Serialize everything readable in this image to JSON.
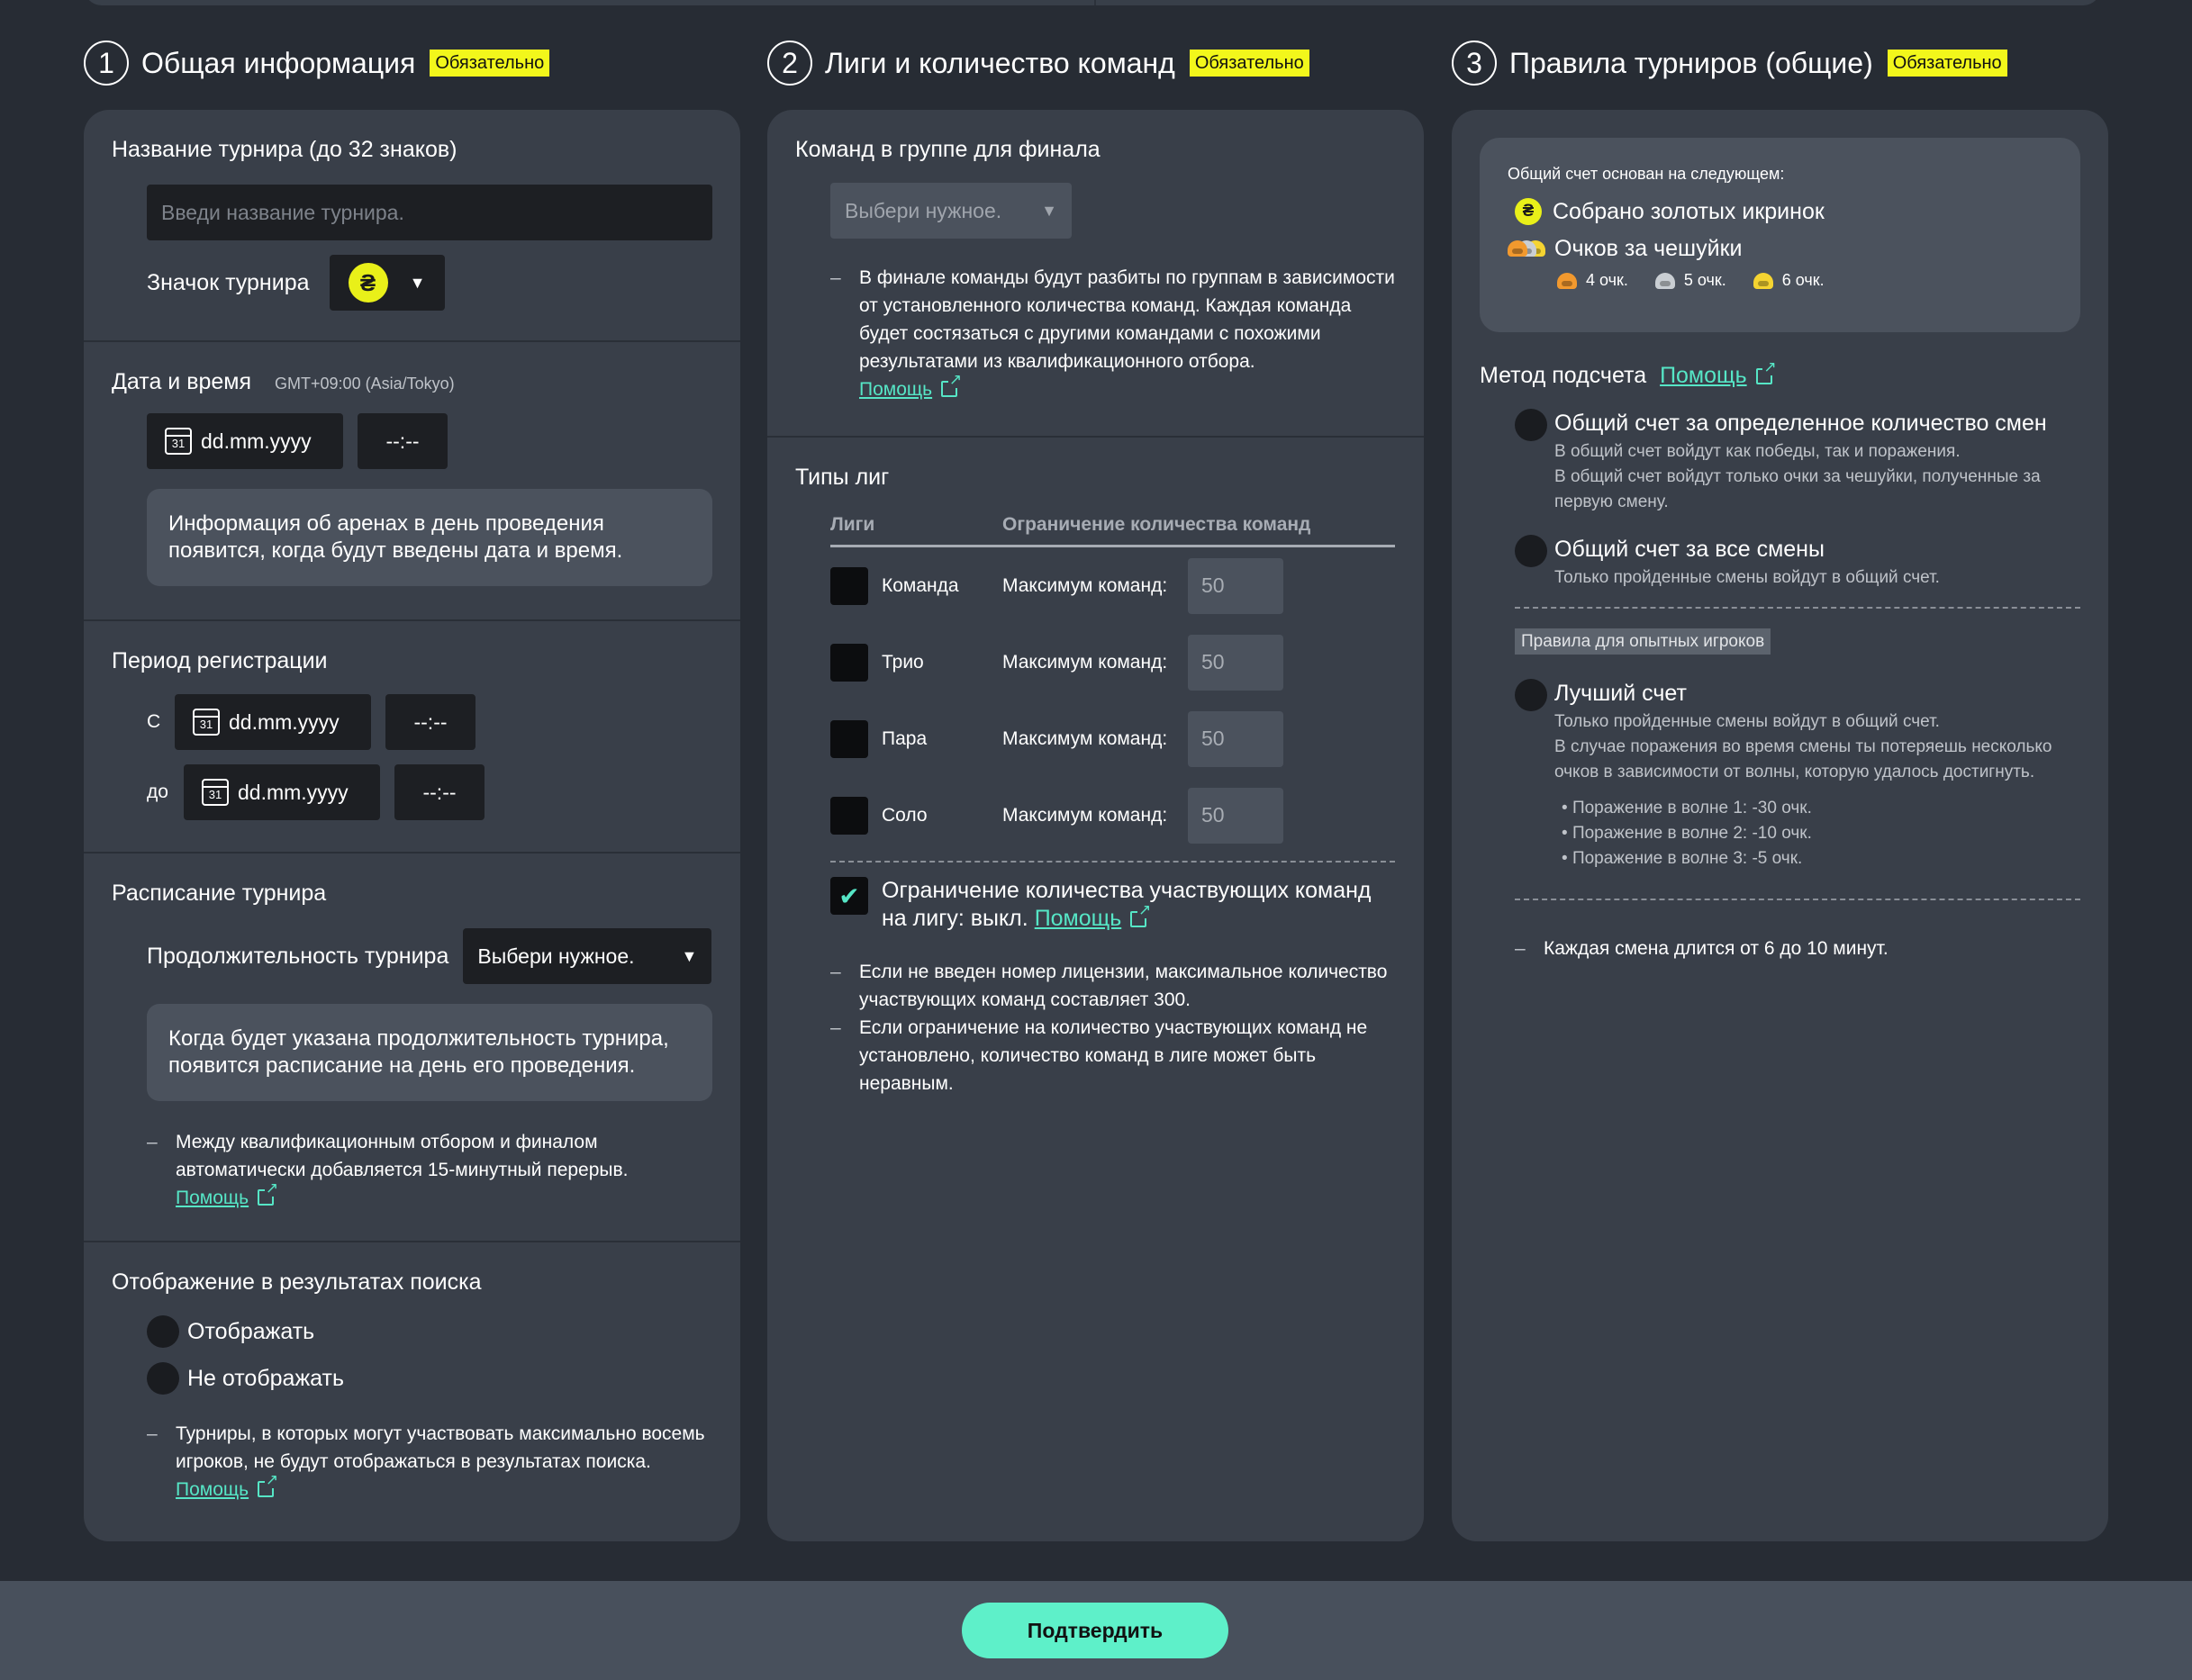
{
  "required_label": "Обязательно",
  "col1": {
    "num": "1",
    "title": "Общая информация",
    "name_label": "Название турнира (до 32 знаков)",
    "name_placeholder": "Введи название турнира.",
    "icon_label": "Значок турнира",
    "date_label": "Дата и время",
    "timezone": "GMT+09:00 (Asia/Tokyo)",
    "date_placeholder": "dd.mm.yyyy",
    "time_placeholder": "--:--",
    "calendar_day": "31",
    "arena_info": "Информация об аренах в день проведения появится, когда будут введены дата и время.",
    "reg_label": "Период регистрации",
    "from_label": "С",
    "to_label": "до",
    "schedule_label": "Расписание турнира",
    "duration_label": "Продолжительность турнира",
    "duration_value": "Выбери нужное.",
    "schedule_info": "Когда будет указана продолжительность турнира, появится расписание на день его проведения.",
    "break_note": "Между квалификационным отбором и финалом автоматически добавляется 15-минутный перерыв.",
    "help": "Помощь",
    "search_label": "Отображение в результатах поиска",
    "show": "Отображать",
    "hide": "Не отображать",
    "search_note": "Турниры, в которых могут участвовать максимально восемь игроков, не будут отображаться в результатах поиска."
  },
  "col2": {
    "num": "2",
    "title": "Лиги и количество команд",
    "group_label": "Команд в группе для финала",
    "group_value": "Выбери нужное.",
    "group_note": "В финале команды будут разбиты по группам в зависимости от установленного количества команд. Каждая команда будет состязаться с другими командами с похожими результатами из квалификационного отбора.",
    "help": "Помощь",
    "types_label": "Типы лиг",
    "th_leagues": "Лиги",
    "th_limit": "Ограничение количества команд",
    "max_label": "Максимум команд:",
    "leagues": [
      {
        "name": "Команда",
        "max": "50"
      },
      {
        "name": "Трио",
        "max": "50"
      },
      {
        "name": "Пара",
        "max": "50"
      },
      {
        "name": "Соло",
        "max": "50"
      }
    ],
    "limit_text": "Ограничение количества участвующих команд на лигу: выкл.",
    "note1": "Если не введен номер лицензии, максимальное количество участвующих команд составляет 300.",
    "note2": "Если ограничение на количество участвующих команд не установлено, количество команд в лиге может быть неравным."
  },
  "col3": {
    "num": "3",
    "title": "Правила турниров (общие)",
    "based_on": "Общий счет основан на следующем:",
    "eggs": "Собрано золотых икринок",
    "scales": "Очков за чешуйки",
    "bronze": "4 очк.",
    "silver": "5 очк.",
    "gold": "6 очк.",
    "method_label": "Метод подсчета",
    "help": "Помощь",
    "opt1_title": "Общий счет за определенное количество смен",
    "opt1_d1": "В общий счет войдут как победы, так и поражения.",
    "opt1_d2": "В общий счет войдут только очки за чешуйки, полученные за первую смену.",
    "opt2_title": "Общий счет за все смены",
    "opt2_d1": "Только пройденные смены войдут в общий счет.",
    "expert_badge": "Правила для опытных игроков",
    "opt3_title": "Лучший счет",
    "opt3_d1": "Только пройденные смены войдут в общий счет.",
    "opt3_d2": "В случае поражения во время смены ты потеряешь несколько очков в зависимости от волны, которую удалось достигнуть.",
    "losses": [
      "Поражение в волне 1:  -30 очк.",
      "Поражение в волне 2:  -10 очк.",
      "Поражение в волне 3:    -5 очк."
    ],
    "shift_note": "Каждая смена длится от 6 до 10 минут."
  },
  "confirm": "Подтвердить"
}
